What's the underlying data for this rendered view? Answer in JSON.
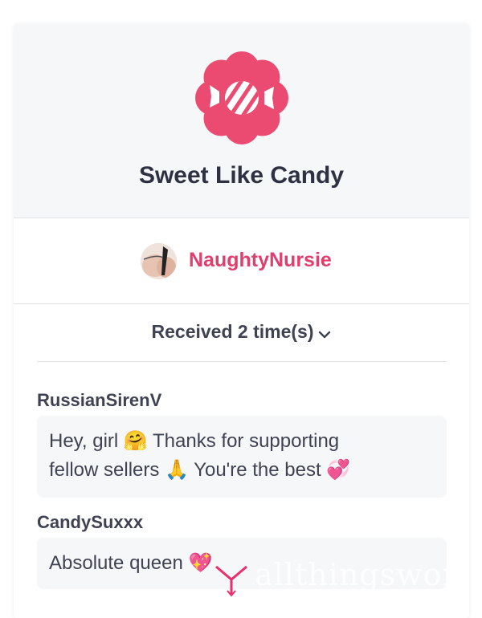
{
  "gift": {
    "title": "Sweet Like Candy",
    "icon": "candy-icon",
    "badge_color": "#ec4b71"
  },
  "sender": {
    "name": "NaughtyNursie",
    "avatar": "avatar-photo"
  },
  "received": {
    "label": "Received 2 time(s)",
    "icon": "chevron-down-icon"
  },
  "comments": [
    {
      "author": "RussianSirenV",
      "text_line1": "Hey, girl 🤗 Thanks for supporting",
      "text_line2": "fellow sellers 🙏 You're the best 💞"
    },
    {
      "author": "CandySuxxx",
      "text_line1": "Absolute queen 💖"
    }
  ],
  "watermark": {
    "text": "allthingsworn"
  },
  "colors": {
    "accent": "#e03e6d",
    "text_dark": "#2e3142",
    "panel_bg": "#f6f7f9"
  }
}
